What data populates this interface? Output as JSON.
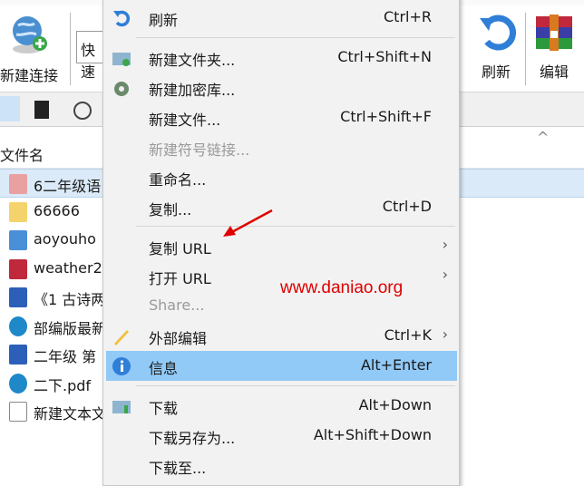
{
  "toolbar": {
    "new_connection": "新建连接",
    "quick": "快速",
    "refresh": "刷新",
    "edit": "编辑"
  },
  "file_list": {
    "column_name": "文件名",
    "files": [
      {
        "name": "6二年级语",
        "icon": "mp4-icon",
        "selected": true
      },
      {
        "name": "66666",
        "icon": "folder-icon"
      },
      {
        "name": "aoyouho",
        "icon": "image-file-icon"
      },
      {
        "name": "weather2",
        "icon": "winrar-icon"
      },
      {
        "name": "《1 古诗两",
        "icon": "word-icon"
      },
      {
        "name": "部编版最新",
        "icon": "edge-pdf-icon"
      },
      {
        "name": "二年级 第",
        "icon": "word-icon"
      },
      {
        "name": "二下.pdf",
        "icon": "edge-pdf-icon"
      },
      {
        "name": "新建文本文",
        "icon": "text-file-icon"
      }
    ]
  },
  "context_menu": {
    "items": [
      {
        "label": "刷新",
        "shortcut": "Ctrl+R",
        "icon": "refresh-icon"
      },
      {
        "label": "新建文件夹...",
        "shortcut": "Ctrl+Shift+N",
        "icon": "new-folder-icon"
      },
      {
        "label": "新建加密库...",
        "shortcut": "",
        "icon": "vault-icon"
      },
      {
        "label": "新建文件...",
        "shortcut": "Ctrl+Shift+F"
      },
      {
        "label": "新建符号链接...",
        "shortcut": "",
        "disabled": true
      },
      {
        "label": "重命名...",
        "shortcut": ""
      },
      {
        "label": "复制...",
        "shortcut": "Ctrl+D"
      },
      {
        "label": "复制 URL",
        "shortcut": "",
        "submenu": true
      },
      {
        "label": "打开 URL",
        "shortcut": "",
        "submenu": true
      },
      {
        "label": "Share...",
        "shortcut": "",
        "disabled": true
      },
      {
        "label": "外部编辑",
        "shortcut": "Ctrl+K",
        "submenu": true,
        "icon": "pencil-icon"
      },
      {
        "label": "信息",
        "shortcut": "Alt+Enter",
        "icon": "info-icon",
        "highlighted": true
      },
      {
        "label": "下载",
        "shortcut": "Alt+Down",
        "icon": "download-icon"
      },
      {
        "label": "下载另存为...",
        "shortcut": "Alt+Shift+Down"
      },
      {
        "label": "下载至...",
        "shortcut": ""
      }
    ],
    "submenu_arrow": "›"
  },
  "watermark": "www.daniao.org",
  "colors": {
    "highlight": "#91c9f7",
    "annotation": "#e00000"
  }
}
